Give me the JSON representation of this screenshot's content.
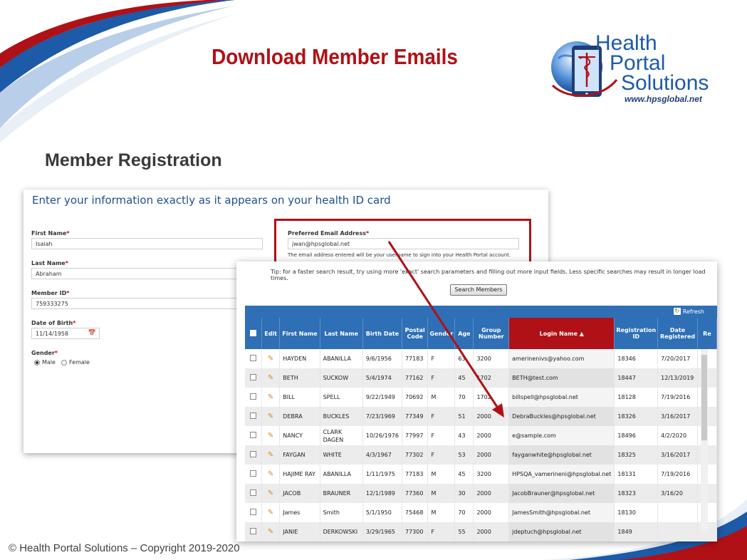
{
  "page": {
    "title": "Download Member Emails",
    "section_title": "Member Registration",
    "copyright": "© Health Portal Solutions – Copyright 2019-2020"
  },
  "logo": {
    "line1": "Health",
    "line2": "Portal",
    "line3": "Solutions",
    "url": "www.hpsglobal.net"
  },
  "colors": {
    "brand_red": "#b01116",
    "brand_blue": "#1d5aa8",
    "grid_header": "#2e6fb6"
  },
  "form": {
    "heading": "Enter your information exactly as it appears on your health ID card",
    "required_mark": "*",
    "first_name": {
      "label": "First Name",
      "value": "Isaiah"
    },
    "last_name": {
      "label": "Last Name",
      "value": "Abraham"
    },
    "member_id": {
      "label": "Member ID",
      "value": "759333275"
    },
    "dob": {
      "label": "Date of Birth",
      "value": "11/14/1958",
      "icon": "calendar-icon"
    },
    "gender": {
      "label": "Gender",
      "options": [
        "Male",
        "Female"
      ],
      "selected": "Male"
    },
    "email": {
      "label": "Preferred Email Address",
      "value": "jwan@hpsglobal.net",
      "help": "The email address entered will be your username to sign into your Health Portal account."
    }
  },
  "search": {
    "tip": "Tip: for a faster search result, try using more 'exact' search parameters and filling out more input fields. Less specific searches may result in longer load times.",
    "button_label": "Search Members",
    "refresh_label": "Refresh"
  },
  "grid": {
    "columns": [
      "Edit",
      "First Name",
      "Last Name",
      "Birth Date",
      "Postal Code",
      "Gender",
      "Age",
      "Group Number",
      "Login Name ▲",
      "Registration ID",
      "Date Registered",
      "Re"
    ],
    "sorted_column": "Login Name",
    "rows": [
      [
        "HAYDEN",
        "ABANILLA",
        "9/6/1956",
        "77183",
        "F",
        "63",
        "3200",
        "amerinenivs@yahoo.com",
        "18346",
        "7/20/2017",
        "Re"
      ],
      [
        "BETH",
        "SUCKOW",
        "5/4/1974",
        "77162",
        "F",
        "45",
        "1702",
        "BETH@test.com",
        "18447",
        "12/13/2019",
        "Re"
      ],
      [
        "BILL",
        "SPELL",
        "9/22/1949",
        "70692",
        "M",
        "70",
        "1702",
        "billspell@hpsglobal.net",
        "18128",
        "7/19/2016",
        "Re"
      ],
      [
        "DEBRA",
        "BUCKLES",
        "7/23/1969",
        "77349",
        "F",
        "51",
        "2000",
        "DebraBuckles@hpsglobal.net",
        "18326",
        "3/16/2017",
        "Re"
      ],
      [
        "NANCY",
        "CLARK DAGEN",
        "10/26/1976",
        "77997",
        "F",
        "43",
        "2000",
        "e@sample.com",
        "18496",
        "4/2/2020",
        "Re"
      ],
      [
        "FAYGAN",
        "WHITE",
        "4/3/1967",
        "77302",
        "F",
        "53",
        "2000",
        "fayganwhite@hpsglobal.net",
        "18325",
        "3/16/2017",
        "Re"
      ],
      [
        "HAJIME RAY",
        "ABANILLA",
        "1/11/1975",
        "77183",
        "M",
        "45",
        "3200",
        "HPSQA_vamerineni@hpsglobal.net",
        "18131",
        "7/19/2016",
        "R"
      ],
      [
        "JACOB",
        "BRAUNER",
        "12/1/1989",
        "77360",
        "M",
        "30",
        "2000",
        "JacobBrauner@hpsglobal.net",
        "18323",
        "3/16/20",
        ""
      ],
      [
        "James",
        "Smith",
        "5/1/1950",
        "75468",
        "M",
        "70",
        "2000",
        "JamesSmith@hpsglobal.net",
        "18130",
        "",
        ""
      ],
      [
        "JANIE",
        "DERKOWSKI",
        "3/29/1965",
        "77300",
        "F",
        "55",
        "2000",
        "jdeptuch@hpsglobal.net",
        "1849",
        "",
        ""
      ]
    ]
  }
}
